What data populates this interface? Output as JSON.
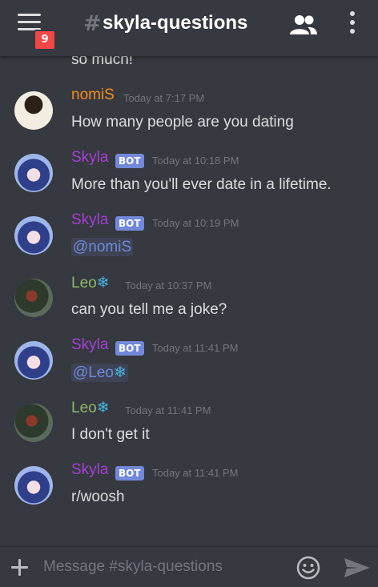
{
  "header": {
    "unread_badge": "9",
    "channel_hash": "#",
    "channel_name": "skyla-questions"
  },
  "messages": {
    "continuation_text": "so much!",
    "items": [
      {
        "author": "nomiS",
        "author_color": "#f78c1e",
        "bot": false,
        "timestamp": "Today at 7:17 PM",
        "content": "How many people are you dating"
      },
      {
        "author": "Skyla",
        "author_color": "#a43fd6",
        "bot": true,
        "bot_label": "BOT",
        "timestamp": "Today at 10:18 PM",
        "content": "More than you'll ever date in a lifetime."
      },
      {
        "author": "Skyla",
        "author_color": "#a43fd6",
        "bot": true,
        "bot_label": "BOT",
        "timestamp": "Today at 10:19 PM",
        "content": "@nomiS"
      },
      {
        "author": "Leo",
        "author_suffix": "❄",
        "author_color": "#8fb86a",
        "bot": false,
        "timestamp": "Today at 10:37 PM",
        "content": "can you tell me a joke?"
      },
      {
        "author": "Skyla",
        "author_color": "#a43fd6",
        "bot": true,
        "bot_label": "BOT",
        "timestamp": "Today at 11:41 PM",
        "content": "@Leo",
        "content_suffix": "❄"
      },
      {
        "author": "Leo",
        "author_suffix": "❄",
        "author_color": "#8fb86a",
        "bot": false,
        "timestamp": "Today at 11:41 PM",
        "content": "I don't get it"
      },
      {
        "author": "Skyla",
        "author_color": "#a43fd6",
        "bot": true,
        "bot_label": "BOT",
        "timestamp": "Today at 11:41 PM",
        "content": "r/woosh"
      }
    ]
  },
  "composer": {
    "placeholder": "Message #skyla-questions"
  },
  "icons": {
    "menu": "hamburger-menu-icon",
    "members": "members-icon",
    "more": "more-vertical-icon",
    "add": "plus-icon",
    "emoji": "emoji-icon",
    "send": "send-icon"
  },
  "colors": {
    "background": "#36393f",
    "badge": "#f04747",
    "bot_tag": "#7289da",
    "mention": "#7289da"
  }
}
